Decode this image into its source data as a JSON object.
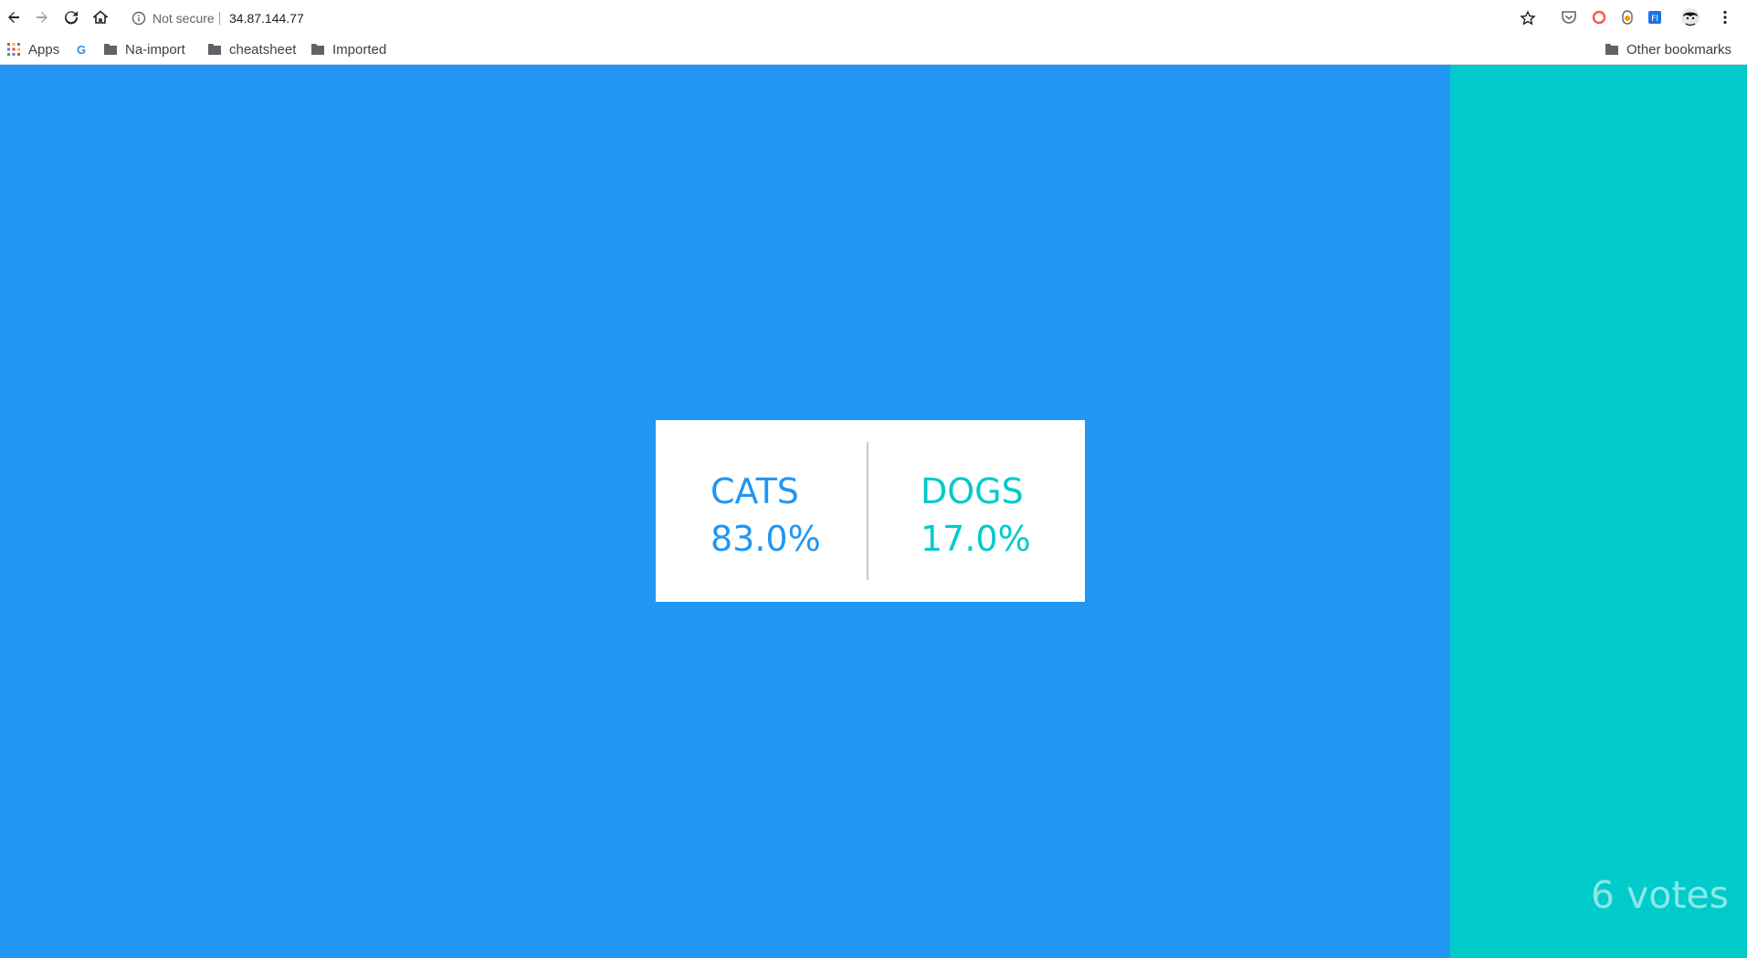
{
  "browser": {
    "security_label": "Not secure",
    "url": "34.87.144.77",
    "bookmarks": [
      {
        "label": "Apps",
        "icon": "apps-grid-icon"
      },
      {
        "label": "",
        "icon": "google-icon"
      },
      {
        "label": "Na-import",
        "icon": "folder-icon"
      },
      {
        "label": "cheatsheet",
        "icon": "folder-icon"
      },
      {
        "label": "Imported",
        "icon": "folder-icon"
      }
    ],
    "other_bookmarks": "Other bookmarks",
    "extensions": [
      "pocket-icon",
      "ext-red-icon",
      "ext-orange-icon",
      "ext-blue-icon",
      "profile-avatar-icon",
      "menu-dots-icon"
    ]
  },
  "result": {
    "option_a": {
      "name": "CATS",
      "percent": "83.0%",
      "fraction": 0.83
    },
    "option_b": {
      "name": "DOGS",
      "percent": "17.0%",
      "fraction": 0.17
    },
    "votes": "6 votes"
  },
  "colors": {
    "option_a": "#2196f3",
    "option_b": "#00cbca"
  }
}
